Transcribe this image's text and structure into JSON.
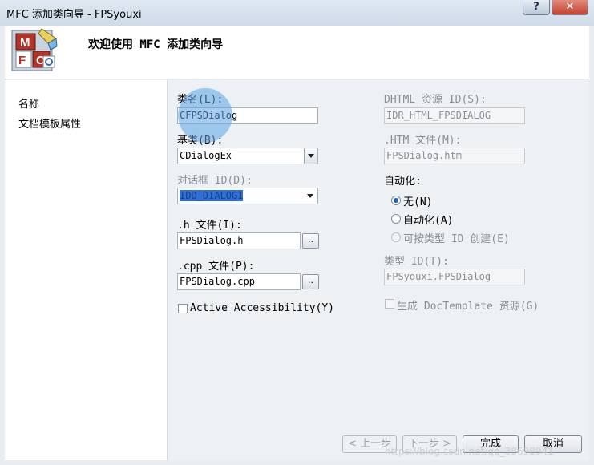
{
  "window": {
    "title": "MFC 添加类向导 - FPSyouxi",
    "help_label": "?",
    "close_label": "✕"
  },
  "header": {
    "title": "欢迎使用 MFC 添加类向导",
    "logo_letters": [
      "M",
      "F",
      "C"
    ]
  },
  "nav": {
    "items": [
      {
        "label": "名称"
      },
      {
        "label": "文档模板属性"
      }
    ]
  },
  "form": {
    "class_name_label": "类名(L):",
    "class_name_value": "CFPSDialog",
    "base_class_label": "基类(B):",
    "base_class_value": "CDialogEx",
    "dialog_id_label": "对话框 ID(D):",
    "dialog_id_value": "IDD_DIALOG1",
    "h_file_label": ".h 文件(I):",
    "h_file_value": "FPSDialog.h",
    "cpp_file_label": ".cpp 文件(P):",
    "cpp_file_value": "FPSDialog.cpp",
    "browse_label": "..",
    "accessibility_label": "Active Accessibility(Y)",
    "dhtml_label": "DHTML 资源 ID(S):",
    "dhtml_value": "IDR_HTML_FPSDIALOG",
    "htm_label": ".HTM 文件(M):",
    "htm_value": "FPSDialog.htm",
    "automation_label": "自动化:",
    "automation_options": [
      {
        "label": "无(N)",
        "checked": true,
        "enabled": true
      },
      {
        "label": "自动化(A)",
        "checked": false,
        "enabled": true
      },
      {
        "label": "可按类型 ID 创建(E)",
        "checked": false,
        "enabled": false
      }
    ],
    "type_id_label": "类型 ID(T):",
    "type_id_value": "FPSyouxi.FPSDialog",
    "doctemplate_label": "生成 DocTemplate 资源(G)"
  },
  "buttons": {
    "prev": "< 上一步",
    "next": "下一步 >",
    "finish": "完成",
    "cancel": "取消"
  },
  "watermark": "https://blog.csdn.net/qq_38698941"
}
